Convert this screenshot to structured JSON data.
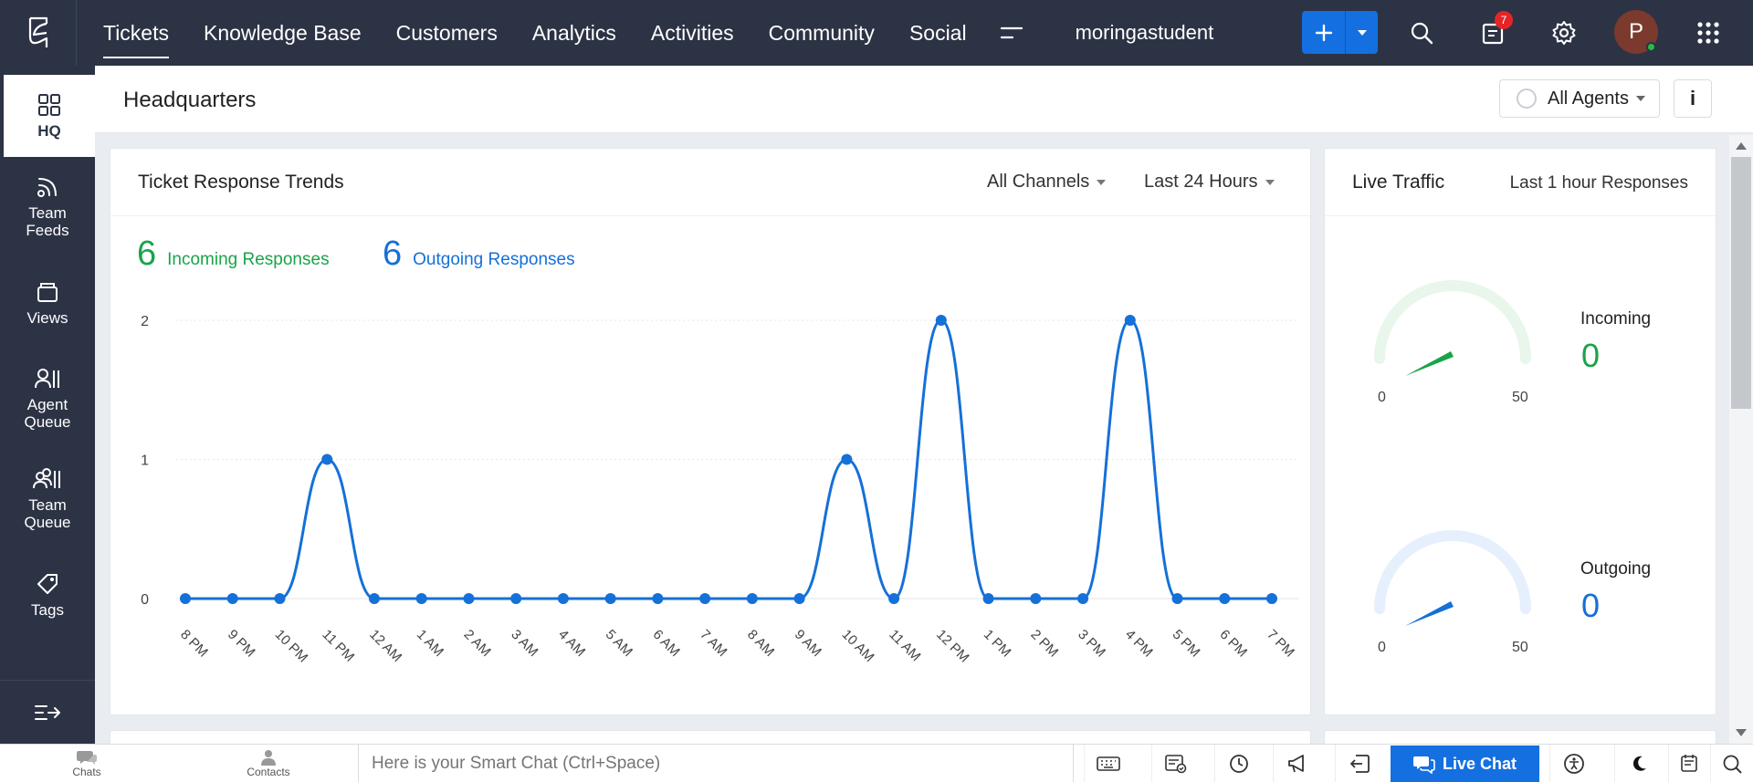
{
  "topbar": {
    "logo_icon": "zoho-desk-logo-icon",
    "nav": [
      "Tickets",
      "Knowledge Base",
      "Customers",
      "Analytics",
      "Activities",
      "Community",
      "Social"
    ],
    "active_nav": "Tickets",
    "org_name": "moringastudent",
    "notification_count": "7",
    "avatar_initial": "P",
    "icons": [
      "plus-icon",
      "caret-down-icon",
      "search-icon",
      "notification-icon",
      "gear-icon",
      "apps-grid-icon"
    ]
  },
  "sidebar": {
    "items": [
      {
        "label": "HQ",
        "icon": "grid-icon"
      },
      {
        "label": "Team\nFeeds",
        "icon": "feed-icon"
      },
      {
        "label": "Views",
        "icon": "views-icon"
      },
      {
        "label": "Agent\nQueue",
        "icon": "agent-queue-icon"
      },
      {
        "label": "Team\nQueue",
        "icon": "team-queue-icon"
      },
      {
        "label": "Tags",
        "icon": "tag-icon"
      }
    ],
    "active": "HQ"
  },
  "header": {
    "title": "Headquarters",
    "agents_filter": "All Agents",
    "info_label": "i"
  },
  "trends_card": {
    "title": "Ticket Response Trends",
    "channel_filter": "All Channels",
    "time_filter": "Last 24 Hours",
    "incoming_count": "6",
    "incoming_label": "Incoming Responses",
    "outgoing_count": "6",
    "outgoing_label": "Outgoing Responses"
  },
  "chart_data": {
    "type": "line",
    "title": "Ticket Response Trends",
    "xlabel": "",
    "ylabel": "",
    "categories": [
      "8 PM",
      "9 PM",
      "10 PM",
      "11 PM",
      "12 AM",
      "1 AM",
      "2 AM",
      "3 AM",
      "4 AM",
      "5 AM",
      "6 AM",
      "7 AM",
      "8 AM",
      "9 AM",
      "10 AM",
      "11 AM",
      "12 PM",
      "1 PM",
      "2 PM",
      "3 PM",
      "4 PM",
      "5 PM",
      "6 PM",
      "7 PM"
    ],
    "series": [
      {
        "values": [
          0,
          0,
          0,
          1,
          0,
          0,
          0,
          0,
          0,
          0,
          0,
          0,
          0,
          0,
          1,
          0,
          2,
          0,
          0,
          0,
          2,
          0,
          0,
          0
        ],
        "color": "#1570d8"
      }
    ],
    "yticks": [
      "0",
      "1",
      "2"
    ],
    "ylim": [
      0,
      2
    ],
    "grid": true
  },
  "live_traffic": {
    "title": "Live Traffic",
    "subtitle": "Last 1 hour Responses",
    "incoming": {
      "label": "Incoming",
      "value": "0",
      "min": "0",
      "max": "50",
      "color": "#1aa34a",
      "track": "#e8f6ec"
    },
    "outgoing": {
      "label": "Outgoing",
      "value": "0",
      "min": "0",
      "max": "50",
      "color": "#1570d8",
      "track": "#e6f0fc"
    }
  },
  "bottombar": {
    "chats_label": "Chats",
    "contacts_label": "Contacts",
    "smart_chat_placeholder": "Here is your Smart Chat (Ctrl+Space)",
    "live_chat_label": "Live Chat",
    "icons": [
      "keyboard-icon",
      "checklist-icon",
      "clock-icon",
      "megaphone-icon",
      "transfer-icon",
      "accessibility-icon",
      "moon-icon",
      "notes-icon",
      "search-icon"
    ]
  }
}
